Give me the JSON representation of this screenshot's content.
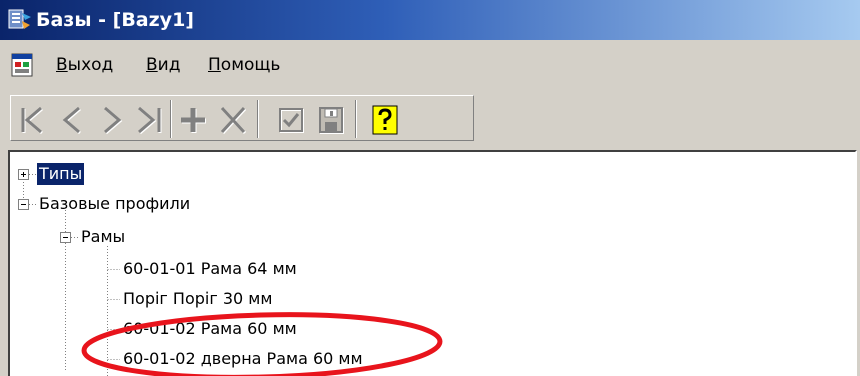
{
  "window": {
    "title": "Базы - [Bazy1]"
  },
  "menu": {
    "items": [
      {
        "accel": "В",
        "rest": "ыход"
      },
      {
        "accel": "В",
        "rest": "ид"
      },
      {
        "accel": "П",
        "rest": "омощь"
      }
    ]
  },
  "toolbar": {
    "buttons": [
      "first-record-icon",
      "previous-record-icon",
      "next-record-icon",
      "last-record-icon",
      "add-record-icon",
      "delete-record-icon",
      "confirm-checkbox-icon",
      "save-disk-icon",
      "help-icon"
    ]
  },
  "tree": {
    "nodes": [
      {
        "label": "Типы",
        "expander": "+",
        "selected": true
      },
      {
        "label": "Базовые профили",
        "expander": "-",
        "selected": false
      },
      {
        "label": "Рамы",
        "expander": "-",
        "selected": false
      },
      {
        "label": "60-01-01 Рама 64 мм",
        "selected": false
      },
      {
        "label": "Поріг Поріг 30 мм",
        "selected": false
      },
      {
        "label": "60-01-02 Рама 60 мм",
        "selected": false
      },
      {
        "label": "60-01-02 дверна Рама 60 мм",
        "selected": false
      }
    ]
  },
  "colors": {
    "title_gradient_start": "#0a246a",
    "title_gradient_end": "#a6caf0",
    "selection": "#0a246a",
    "annotation_ellipse": "#e8141c",
    "chrome": "#d4d0c8"
  }
}
